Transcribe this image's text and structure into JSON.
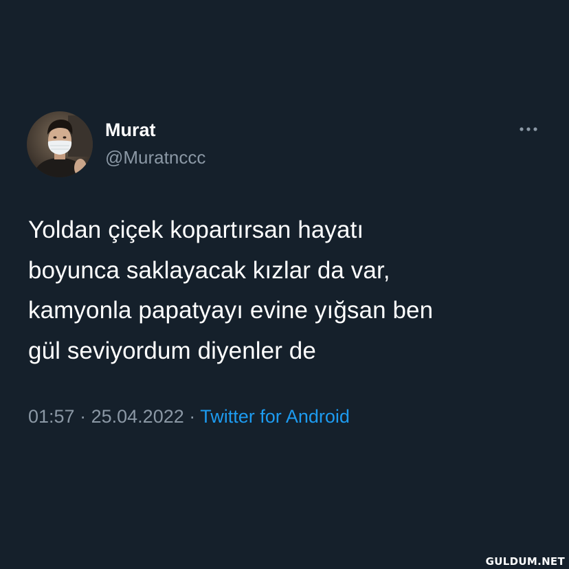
{
  "tweet": {
    "author": {
      "display_name": "Murat",
      "handle": "@Muratnccc",
      "avatar_icon": "profile-photo"
    },
    "more_icon": "more-horizontal-icon",
    "text": "Yoldan çiçek kopartırsan hayatı\nboyunca saklayacak kızlar da var,\nkamyonla papatyayı evine yığsan ben\ngül seviyordum diyenler de",
    "time": "01:57",
    "separator": "·",
    "date": "25.04.2022",
    "source": "Twitter for Android"
  },
  "watermark": "GULDUM.NET",
  "colors": {
    "background": "#15202b",
    "text": "#ffffff",
    "muted": "#8b98a5",
    "accent": "#1d9bf0"
  }
}
